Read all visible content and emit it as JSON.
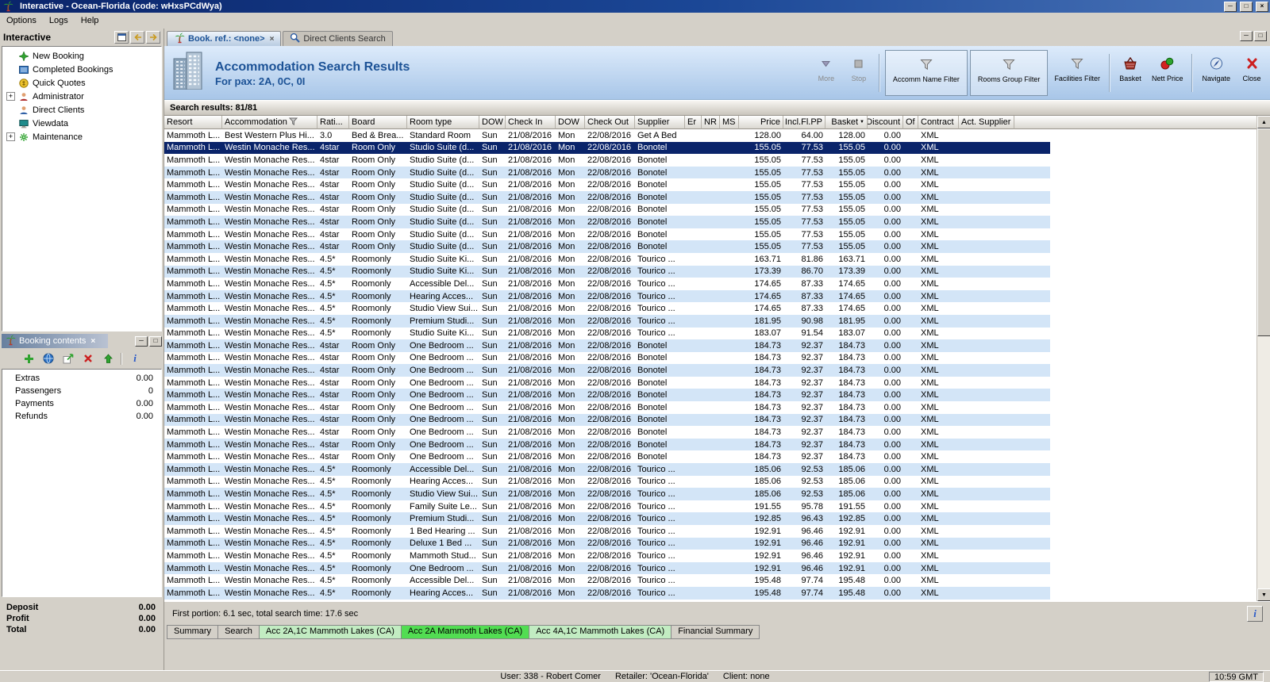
{
  "window": {
    "title": "Interactive - Ocean-Florida (code: wHxsPCdWya)"
  },
  "menu": {
    "items": [
      {
        "label": "Options"
      },
      {
        "label": "Logs"
      },
      {
        "label": "Help"
      }
    ]
  },
  "sidebar": {
    "title": "Interactive",
    "items": [
      {
        "label": "New Booking",
        "icon": "new-booking-icon",
        "expandable": false
      },
      {
        "label": "Completed Bookings",
        "icon": "completed-bookings-icon",
        "expandable": false
      },
      {
        "label": "Quick Quotes",
        "icon": "quick-quotes-icon",
        "expandable": false
      },
      {
        "label": "Administrator",
        "icon": "administrator-icon",
        "expandable": true
      },
      {
        "label": "Direct Clients",
        "icon": "direct-clients-icon",
        "expandable": false
      },
      {
        "label": "Viewdata",
        "icon": "viewdata-icon",
        "expandable": false
      },
      {
        "label": "Maintenance",
        "icon": "maintenance-icon",
        "expandable": true
      }
    ]
  },
  "booking_contents": {
    "title": "Booking contents",
    "rows": [
      {
        "label": "Extras",
        "value": "0.00"
      },
      {
        "label": "Passengers",
        "value": "0"
      },
      {
        "label": "Payments",
        "value": "0.00"
      },
      {
        "label": "Refunds",
        "value": "0.00"
      }
    ],
    "summary": [
      {
        "label": "Deposit",
        "value": "0.00"
      },
      {
        "label": "Profit",
        "value": "0.00"
      },
      {
        "label": "Total",
        "value": "0.00"
      }
    ]
  },
  "tabs": [
    {
      "label": "Book. ref.: <none>",
      "active": true
    },
    {
      "label": "Direct Clients Search",
      "active": false
    }
  ],
  "header": {
    "title": "Accommodation Search Results",
    "subtitle": "For pax: 2A, 0C, 0I",
    "toolbar": {
      "more": "More",
      "stop": "Stop",
      "accomm_name_filter": "Accomm Name Filter",
      "rooms_group_filter": "Rooms Group Filter",
      "facilities_filter": "Facilities Filter",
      "basket": "Basket",
      "nett_price": "Nett Price",
      "navigate": "Navigate",
      "close": "Close"
    }
  },
  "results": {
    "text": "Search results: 81/81"
  },
  "table": {
    "selected_index": 1,
    "columns": [
      "Resort",
      "Accommodation",
      "Rati...",
      "Board",
      "Room type",
      "DOW",
      "Check In",
      "DOW",
      "Check Out",
      "Supplier",
      "Er",
      "NR",
      "MS",
      "Price",
      "Incl.Fl.PP",
      "Basket",
      "Discount",
      "Of",
      "Contract",
      "Act. Supplier"
    ],
    "rows": [
      [
        "Mammoth L...",
        "Best Western Plus Hi...",
        "3.0",
        "Bed & Brea...",
        "Standard Room",
        "Sun",
        "21/08/2016",
        "Mon",
        "22/08/2016",
        "Get A Bed",
        "",
        "",
        "",
        "128.00",
        "64.00",
        "128.00",
        "0.00",
        "",
        "XML",
        ""
      ],
      [
        "Mammoth L...",
        "Westin Monache Res...",
        "4star",
        "Room Only",
        "Studio Suite (d...",
        "Sun",
        "21/08/2016",
        "Mon",
        "22/08/2016",
        "Bonotel",
        "",
        "",
        "",
        "155.05",
        "77.53",
        "155.05",
        "0.00",
        "",
        "XML",
        ""
      ],
      [
        "Mammoth L...",
        "Westin Monache Res...",
        "4star",
        "Room Only",
        "Studio Suite (d...",
        "Sun",
        "21/08/2016",
        "Mon",
        "22/08/2016",
        "Bonotel",
        "",
        "",
        "",
        "155.05",
        "77.53",
        "155.05",
        "0.00",
        "",
        "XML",
        ""
      ],
      [
        "Mammoth L...",
        "Westin Monache Res...",
        "4star",
        "Room Only",
        "Studio Suite (d...",
        "Sun",
        "21/08/2016",
        "Mon",
        "22/08/2016",
        "Bonotel",
        "",
        "",
        "",
        "155.05",
        "77.53",
        "155.05",
        "0.00",
        "",
        "XML",
        ""
      ],
      [
        "Mammoth L...",
        "Westin Monache Res...",
        "4star",
        "Room Only",
        "Studio Suite (d...",
        "Sun",
        "21/08/2016",
        "Mon",
        "22/08/2016",
        "Bonotel",
        "",
        "",
        "",
        "155.05",
        "77.53",
        "155.05",
        "0.00",
        "",
        "XML",
        ""
      ],
      [
        "Mammoth L...",
        "Westin Monache Res...",
        "4star",
        "Room Only",
        "Studio Suite (d...",
        "Sun",
        "21/08/2016",
        "Mon",
        "22/08/2016",
        "Bonotel",
        "",
        "",
        "",
        "155.05",
        "77.53",
        "155.05",
        "0.00",
        "",
        "XML",
        ""
      ],
      [
        "Mammoth L...",
        "Westin Monache Res...",
        "4star",
        "Room Only",
        "Studio Suite (d...",
        "Sun",
        "21/08/2016",
        "Mon",
        "22/08/2016",
        "Bonotel",
        "",
        "",
        "",
        "155.05",
        "77.53",
        "155.05",
        "0.00",
        "",
        "XML",
        ""
      ],
      [
        "Mammoth L...",
        "Westin Monache Res...",
        "4star",
        "Room Only",
        "Studio Suite (d...",
        "Sun",
        "21/08/2016",
        "Mon",
        "22/08/2016",
        "Bonotel",
        "",
        "",
        "",
        "155.05",
        "77.53",
        "155.05",
        "0.00",
        "",
        "XML",
        ""
      ],
      [
        "Mammoth L...",
        "Westin Monache Res...",
        "4star",
        "Room Only",
        "Studio Suite (d...",
        "Sun",
        "21/08/2016",
        "Mon",
        "22/08/2016",
        "Bonotel",
        "",
        "",
        "",
        "155.05",
        "77.53",
        "155.05",
        "0.00",
        "",
        "XML",
        ""
      ],
      [
        "Mammoth L...",
        "Westin Monache Res...",
        "4star",
        "Room Only",
        "Studio Suite (d...",
        "Sun",
        "21/08/2016",
        "Mon",
        "22/08/2016",
        "Bonotel",
        "",
        "",
        "",
        "155.05",
        "77.53",
        "155.05",
        "0.00",
        "",
        "XML",
        ""
      ],
      [
        "Mammoth L...",
        "Westin Monache Res...",
        "4.5*",
        "Roomonly",
        "Studio Suite Ki...",
        "Sun",
        "21/08/2016",
        "Mon",
        "22/08/2016",
        "Tourico ...",
        "",
        "",
        "",
        "163.71",
        "81.86",
        "163.71",
        "0.00",
        "",
        "XML",
        ""
      ],
      [
        "Mammoth L...",
        "Westin Monache Res...",
        "4.5*",
        "Roomonly",
        "Studio Suite Ki...",
        "Sun",
        "21/08/2016",
        "Mon",
        "22/08/2016",
        "Tourico ...",
        "",
        "",
        "",
        "173.39",
        "86.70",
        "173.39",
        "0.00",
        "",
        "XML",
        ""
      ],
      [
        "Mammoth L...",
        "Westin Monache Res...",
        "4.5*",
        "Roomonly",
        "Accessible Del...",
        "Sun",
        "21/08/2016",
        "Mon",
        "22/08/2016",
        "Tourico ...",
        "",
        "",
        "",
        "174.65",
        "87.33",
        "174.65",
        "0.00",
        "",
        "XML",
        ""
      ],
      [
        "Mammoth L...",
        "Westin Monache Res...",
        "4.5*",
        "Roomonly",
        "Hearing Acces...",
        "Sun",
        "21/08/2016",
        "Mon",
        "22/08/2016",
        "Tourico ...",
        "",
        "",
        "",
        "174.65",
        "87.33",
        "174.65",
        "0.00",
        "",
        "XML",
        ""
      ],
      [
        "Mammoth L...",
        "Westin Monache Res...",
        "4.5*",
        "Roomonly",
        "Studio View Sui...",
        "Sun",
        "21/08/2016",
        "Mon",
        "22/08/2016",
        "Tourico ...",
        "",
        "",
        "",
        "174.65",
        "87.33",
        "174.65",
        "0.00",
        "",
        "XML",
        ""
      ],
      [
        "Mammoth L...",
        "Westin Monache Res...",
        "4.5*",
        "Roomonly",
        "Premium Studi...",
        "Sun",
        "21/08/2016",
        "Mon",
        "22/08/2016",
        "Tourico ...",
        "",
        "",
        "",
        "181.95",
        "90.98",
        "181.95",
        "0.00",
        "",
        "XML",
        ""
      ],
      [
        "Mammoth L...",
        "Westin Monache Res...",
        "4.5*",
        "Roomonly",
        "Studio Suite Ki...",
        "Sun",
        "21/08/2016",
        "Mon",
        "22/08/2016",
        "Tourico ...",
        "",
        "",
        "",
        "183.07",
        "91.54",
        "183.07",
        "0.00",
        "",
        "XML",
        ""
      ],
      [
        "Mammoth L...",
        "Westin Monache Res...",
        "4star",
        "Room Only",
        "One Bedroom ...",
        "Sun",
        "21/08/2016",
        "Mon",
        "22/08/2016",
        "Bonotel",
        "",
        "",
        "",
        "184.73",
        "92.37",
        "184.73",
        "0.00",
        "",
        "XML",
        ""
      ],
      [
        "Mammoth L...",
        "Westin Monache Res...",
        "4star",
        "Room Only",
        "One Bedroom ...",
        "Sun",
        "21/08/2016",
        "Mon",
        "22/08/2016",
        "Bonotel",
        "",
        "",
        "",
        "184.73",
        "92.37",
        "184.73",
        "0.00",
        "",
        "XML",
        ""
      ],
      [
        "Mammoth L...",
        "Westin Monache Res...",
        "4star",
        "Room Only",
        "One Bedroom ...",
        "Sun",
        "21/08/2016",
        "Mon",
        "22/08/2016",
        "Bonotel",
        "",
        "",
        "",
        "184.73",
        "92.37",
        "184.73",
        "0.00",
        "",
        "XML",
        ""
      ],
      [
        "Mammoth L...",
        "Westin Monache Res...",
        "4star",
        "Room Only",
        "One Bedroom ...",
        "Sun",
        "21/08/2016",
        "Mon",
        "22/08/2016",
        "Bonotel",
        "",
        "",
        "",
        "184.73",
        "92.37",
        "184.73",
        "0.00",
        "",
        "XML",
        ""
      ],
      [
        "Mammoth L...",
        "Westin Monache Res...",
        "4star",
        "Room Only",
        "One Bedroom ...",
        "Sun",
        "21/08/2016",
        "Mon",
        "22/08/2016",
        "Bonotel",
        "",
        "",
        "",
        "184.73",
        "92.37",
        "184.73",
        "0.00",
        "",
        "XML",
        ""
      ],
      [
        "Mammoth L...",
        "Westin Monache Res...",
        "4star",
        "Room Only",
        "One Bedroom ...",
        "Sun",
        "21/08/2016",
        "Mon",
        "22/08/2016",
        "Bonotel",
        "",
        "",
        "",
        "184.73",
        "92.37",
        "184.73",
        "0.00",
        "",
        "XML",
        ""
      ],
      [
        "Mammoth L...",
        "Westin Monache Res...",
        "4star",
        "Room Only",
        "One Bedroom ...",
        "Sun",
        "21/08/2016",
        "Mon",
        "22/08/2016",
        "Bonotel",
        "",
        "",
        "",
        "184.73",
        "92.37",
        "184.73",
        "0.00",
        "",
        "XML",
        ""
      ],
      [
        "Mammoth L...",
        "Westin Monache Res...",
        "4star",
        "Room Only",
        "One Bedroom ...",
        "Sun",
        "21/08/2016",
        "Mon",
        "22/08/2016",
        "Bonotel",
        "",
        "",
        "",
        "184.73",
        "92.37",
        "184.73",
        "0.00",
        "",
        "XML",
        ""
      ],
      [
        "Mammoth L...",
        "Westin Monache Res...",
        "4star",
        "Room Only",
        "One Bedroom ...",
        "Sun",
        "21/08/2016",
        "Mon",
        "22/08/2016",
        "Bonotel",
        "",
        "",
        "",
        "184.73",
        "92.37",
        "184.73",
        "0.00",
        "",
        "XML",
        ""
      ],
      [
        "Mammoth L...",
        "Westin Monache Res...",
        "4star",
        "Room Only",
        "One Bedroom ...",
        "Sun",
        "21/08/2016",
        "Mon",
        "22/08/2016",
        "Bonotel",
        "",
        "",
        "",
        "184.73",
        "92.37",
        "184.73",
        "0.00",
        "",
        "XML",
        ""
      ],
      [
        "Mammoth L...",
        "Westin Monache Res...",
        "4.5*",
        "Roomonly",
        "Accessible Del...",
        "Sun",
        "21/08/2016",
        "Mon",
        "22/08/2016",
        "Tourico ...",
        "",
        "",
        "",
        "185.06",
        "92.53",
        "185.06",
        "0.00",
        "",
        "XML",
        ""
      ],
      [
        "Mammoth L...",
        "Westin Monache Res...",
        "4.5*",
        "Roomonly",
        "Hearing Acces...",
        "Sun",
        "21/08/2016",
        "Mon",
        "22/08/2016",
        "Tourico ...",
        "",
        "",
        "",
        "185.06",
        "92.53",
        "185.06",
        "0.00",
        "",
        "XML",
        ""
      ],
      [
        "Mammoth L...",
        "Westin Monache Res...",
        "4.5*",
        "Roomonly",
        "Studio View Sui...",
        "Sun",
        "21/08/2016",
        "Mon",
        "22/08/2016",
        "Tourico ...",
        "",
        "",
        "",
        "185.06",
        "92.53",
        "185.06",
        "0.00",
        "",
        "XML",
        ""
      ],
      [
        "Mammoth L...",
        "Westin Monache Res...",
        "4.5*",
        "Roomonly",
        "Family Suite Le...",
        "Sun",
        "21/08/2016",
        "Mon",
        "22/08/2016",
        "Tourico ...",
        "",
        "",
        "",
        "191.55",
        "95.78",
        "191.55",
        "0.00",
        "",
        "XML",
        ""
      ],
      [
        "Mammoth L...",
        "Westin Monache Res...",
        "4.5*",
        "Roomonly",
        "Premium Studi...",
        "Sun",
        "21/08/2016",
        "Mon",
        "22/08/2016",
        "Tourico ...",
        "",
        "",
        "",
        "192.85",
        "96.43",
        "192.85",
        "0.00",
        "",
        "XML",
        ""
      ],
      [
        "Mammoth L...",
        "Westin Monache Res...",
        "4.5*",
        "Roomonly",
        "1 Bed Hearing ...",
        "Sun",
        "21/08/2016",
        "Mon",
        "22/08/2016",
        "Tourico ...",
        "",
        "",
        "",
        "192.91",
        "96.46",
        "192.91",
        "0.00",
        "",
        "XML",
        ""
      ],
      [
        "Mammoth L...",
        "Westin Monache Res...",
        "4.5*",
        "Roomonly",
        "Deluxe 1 Bed ...",
        "Sun",
        "21/08/2016",
        "Mon",
        "22/08/2016",
        "Tourico ...",
        "",
        "",
        "",
        "192.91",
        "96.46",
        "192.91",
        "0.00",
        "",
        "XML",
        ""
      ],
      [
        "Mammoth L...",
        "Westin Monache Res...",
        "4.5*",
        "Roomonly",
        "Mammoth Stud...",
        "Sun",
        "21/08/2016",
        "Mon",
        "22/08/2016",
        "Tourico ...",
        "",
        "",
        "",
        "192.91",
        "96.46",
        "192.91",
        "0.00",
        "",
        "XML",
        ""
      ],
      [
        "Mammoth L...",
        "Westin Monache Res...",
        "4.5*",
        "Roomonly",
        "One Bedroom ...",
        "Sun",
        "21/08/2016",
        "Mon",
        "22/08/2016",
        "Tourico ...",
        "",
        "",
        "",
        "192.91",
        "96.46",
        "192.91",
        "0.00",
        "",
        "XML",
        ""
      ],
      [
        "Mammoth L...",
        "Westin Monache Res...",
        "4.5*",
        "Roomonly",
        "Accessible Del...",
        "Sun",
        "21/08/2016",
        "Mon",
        "22/08/2016",
        "Tourico ...",
        "",
        "",
        "",
        "195.48",
        "97.74",
        "195.48",
        "0.00",
        "",
        "XML",
        ""
      ],
      [
        "Mammoth L...",
        "Westin Monache Res...",
        "4.5*",
        "Roomonly",
        "Hearing Acces...",
        "Sun",
        "21/08/2016",
        "Mon",
        "22/08/2016",
        "Tourico ...",
        "",
        "",
        "",
        "195.48",
        "97.74",
        "195.48",
        "0.00",
        "",
        "XML",
        ""
      ]
    ]
  },
  "footer": {
    "timing": "First portion: 6.1 sec, total search time: 17.6 sec"
  },
  "bottom_tabs": [
    {
      "label": "Summary",
      "style": "plain"
    },
    {
      "label": "Search",
      "style": "plain"
    },
    {
      "label": "Acc 2A,1C Mammoth Lakes (CA)",
      "style": "green"
    },
    {
      "label": "Acc 2A Mammoth Lakes (CA)",
      "style": "green-active"
    },
    {
      "label": "Acc 4A,1C Mammoth Lakes (CA)",
      "style": "green"
    },
    {
      "label": "Financial Summary",
      "style": "plain"
    }
  ],
  "status": {
    "user": "User: 338 - Robert Comer",
    "retailer": "Retailer: 'Ocean-Florida'",
    "client": "Client: none",
    "time": "10:59 GMT"
  },
  "colors": {
    "selection": "#0a246a",
    "row_stripe": "#d3e5f7",
    "tab_green": "#c2ecc2",
    "tab_green_active": "#52dd52",
    "header_text": "#1c5296"
  }
}
